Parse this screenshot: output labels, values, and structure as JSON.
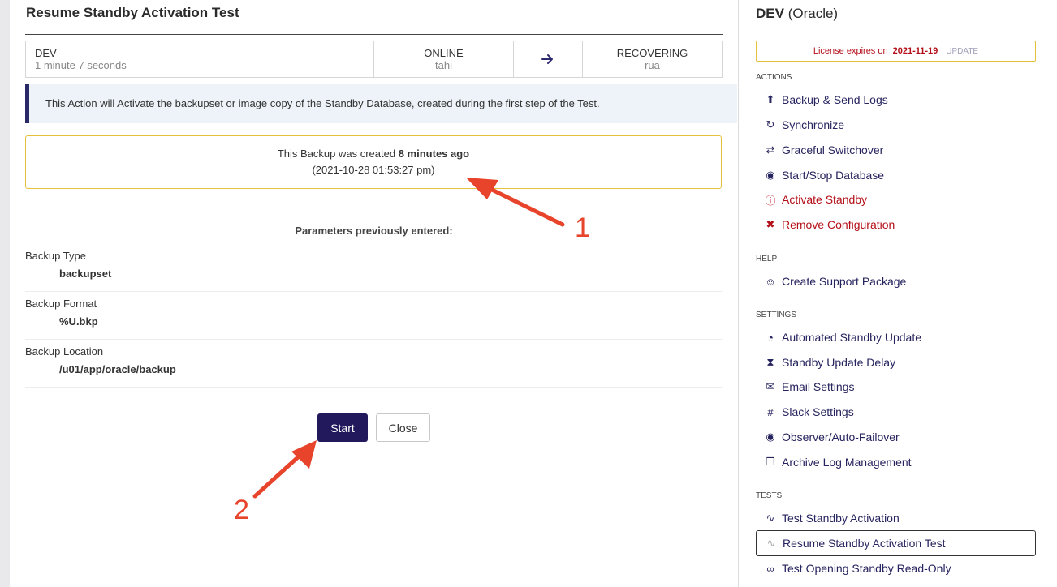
{
  "modal": {
    "title": "Resume Standby Activation Test",
    "status": {
      "db_name": "DEV",
      "db_uptime": "1 minute 7 seconds",
      "source_state": "ONLINE",
      "source_host": "tahi",
      "target_state": "RECOVERING",
      "target_host": "rua"
    },
    "info_text": "This Action will Activate the backupset or image copy of the Standby Database, created during the first step of the Test.",
    "backup": {
      "prefix": "This Backup was created ",
      "age": "8 minutes ago",
      "timestamp": "(2021-10-28 01:53:27 pm)"
    },
    "params_heading": "Parameters previously entered:",
    "params": [
      {
        "label": "Backup Type",
        "value": "backupset"
      },
      {
        "label": "Backup Format",
        "value": "%U.bkp"
      },
      {
        "label": "Backup Location",
        "value": "/u01/app/oracle/backup"
      }
    ],
    "start_label": "Start",
    "close_label": "Close"
  },
  "annotations": {
    "one": "1",
    "two": "2"
  },
  "sidebar": {
    "db_name": "DEV",
    "db_type": "(Oracle)",
    "license": {
      "text": "License expires on",
      "date": "2021-11-19",
      "update": "UPDATE"
    },
    "sections": {
      "actions": "ACTIONS",
      "help": "HELP",
      "settings": "SETTINGS",
      "tests": "TESTS"
    },
    "actions": [
      {
        "label": "Backup & Send Logs",
        "icon": "upload-icon"
      },
      {
        "label": "Synchronize",
        "icon": "sync-icon"
      },
      {
        "label": "Graceful Switchover",
        "icon": "switch-arrows-icon"
      },
      {
        "label": "Start/Stop Database",
        "icon": "stop-circle-icon"
      },
      {
        "label": "Activate Standby",
        "icon": "alert-circle-icon"
      },
      {
        "label": "Remove Configuration",
        "icon": "unlink-icon"
      }
    ],
    "help": [
      {
        "label": "Create Support Package",
        "icon": "support-agent-icon"
      }
    ],
    "settings": [
      {
        "label": "Automated Standby Update",
        "icon": "clock-icon"
      },
      {
        "label": "Standby Update Delay",
        "icon": "hourglass-icon"
      },
      {
        "label": "Email Settings",
        "icon": "envelope-icon"
      },
      {
        "label": "Slack Settings",
        "icon": "slack-icon"
      },
      {
        "label": "Observer/Auto-Failover",
        "icon": "eye-icon"
      },
      {
        "label": "Archive Log Management",
        "icon": "file-plus-icon"
      }
    ],
    "tests": [
      {
        "label": "Test Standby Activation",
        "icon": "pulse-icon"
      },
      {
        "label": "Resume Standby Activation Test",
        "icon": "pulse-icon"
      },
      {
        "label": "Test Opening Standby Read-Only",
        "icon": "glasses-icon"
      }
    ]
  },
  "colors": {
    "primary": "#21195c",
    "danger": "#b40f18",
    "warning_border": "#e5c13b",
    "info_bg": "#eef3f9",
    "annotation": "#e8432b"
  }
}
